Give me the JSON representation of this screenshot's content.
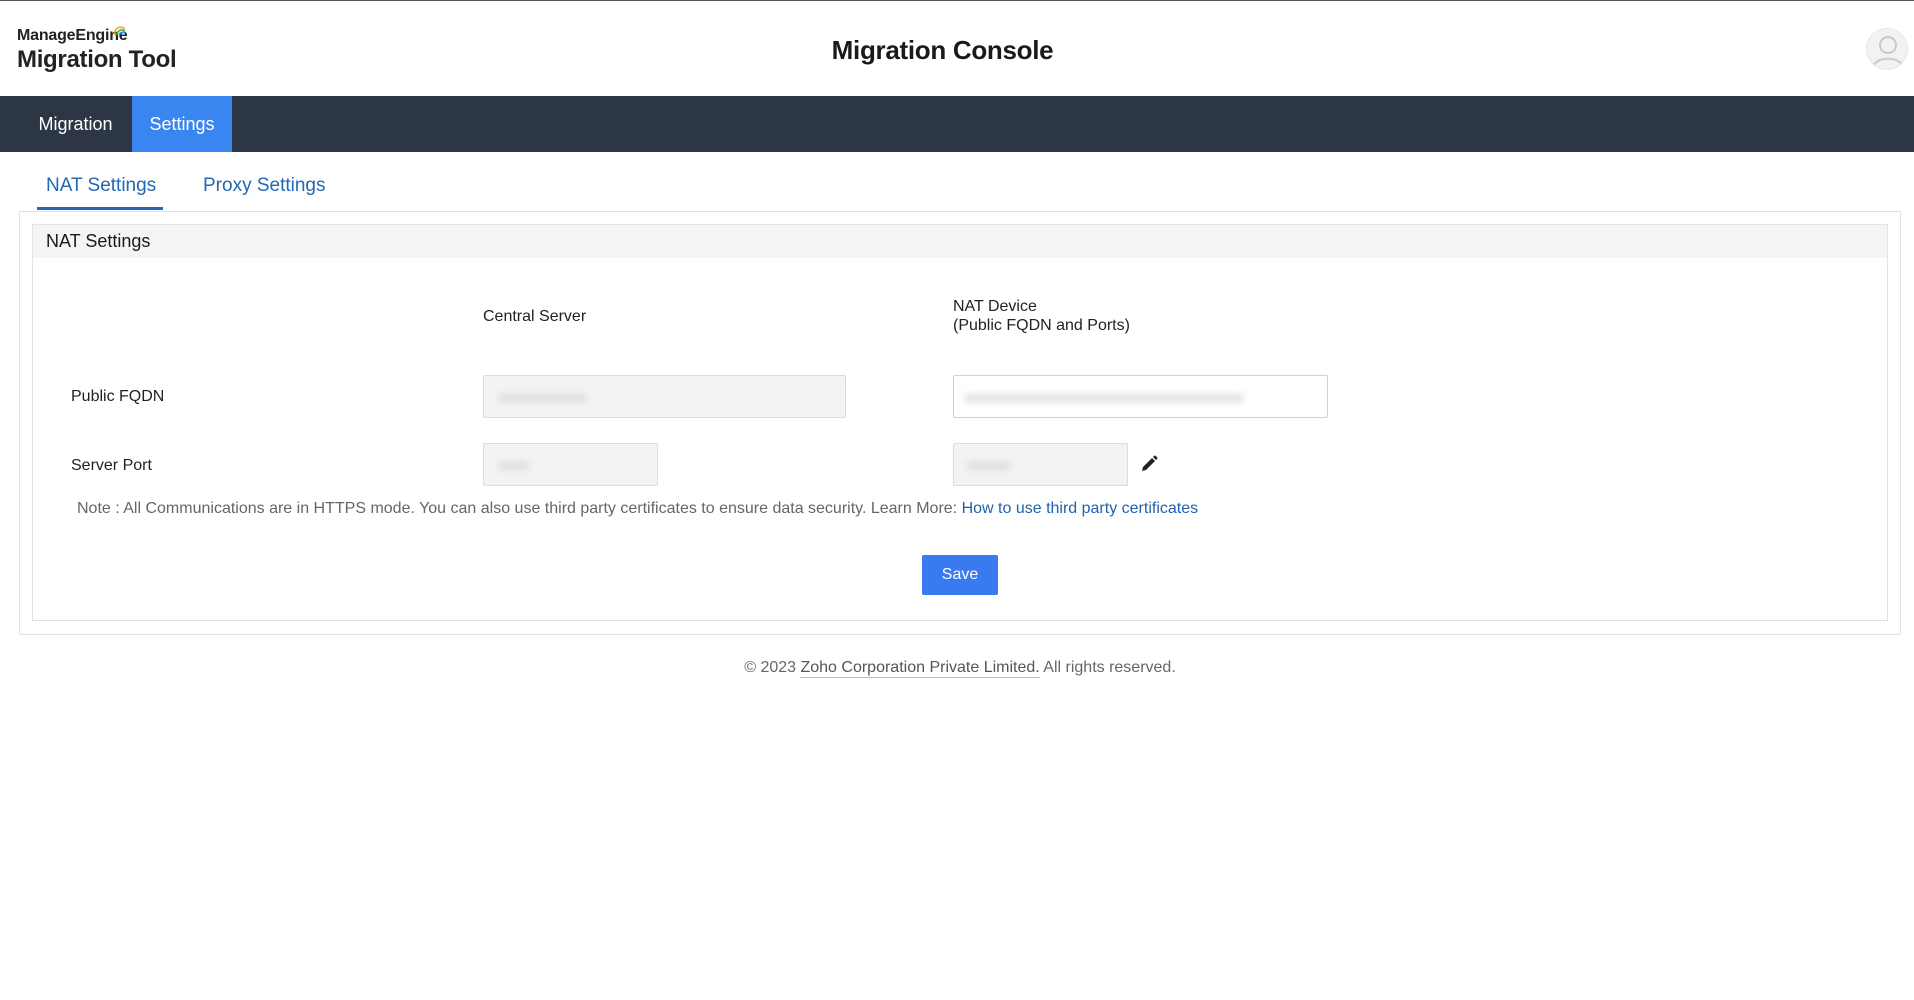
{
  "header": {
    "brand": "ManageEngine",
    "product": "Migration Tool",
    "title": "Migration Console"
  },
  "nav": {
    "items": [
      {
        "label": "Migration",
        "active": false
      },
      {
        "label": "Settings",
        "active": true
      }
    ]
  },
  "tabs": [
    {
      "label": "NAT Settings",
      "active": true
    },
    {
      "label": "Proxy Settings",
      "active": false
    }
  ],
  "section": {
    "title": "NAT Settings",
    "columns": {
      "central": "Central Server",
      "nat_line1": "NAT Device",
      "nat_line2": "(Public FQDN and Ports)"
    },
    "rows": {
      "fqdn": "Public FQDN",
      "port": "Server Port"
    },
    "note_text": "Note : All Communications are in HTTPS mode. You can also use third party certificates to ensure data security. Learn More:",
    "note_link": "How to use third party certificates",
    "save_label": "Save"
  },
  "footer": {
    "prefix": "© 2023",
    "company": "Zoho Corporation Private Limited.",
    "suffix": "All rights reserved."
  },
  "colors": {
    "navbar": "#2d3645",
    "accent": "#3a86f1",
    "link": "#2168b5"
  }
}
